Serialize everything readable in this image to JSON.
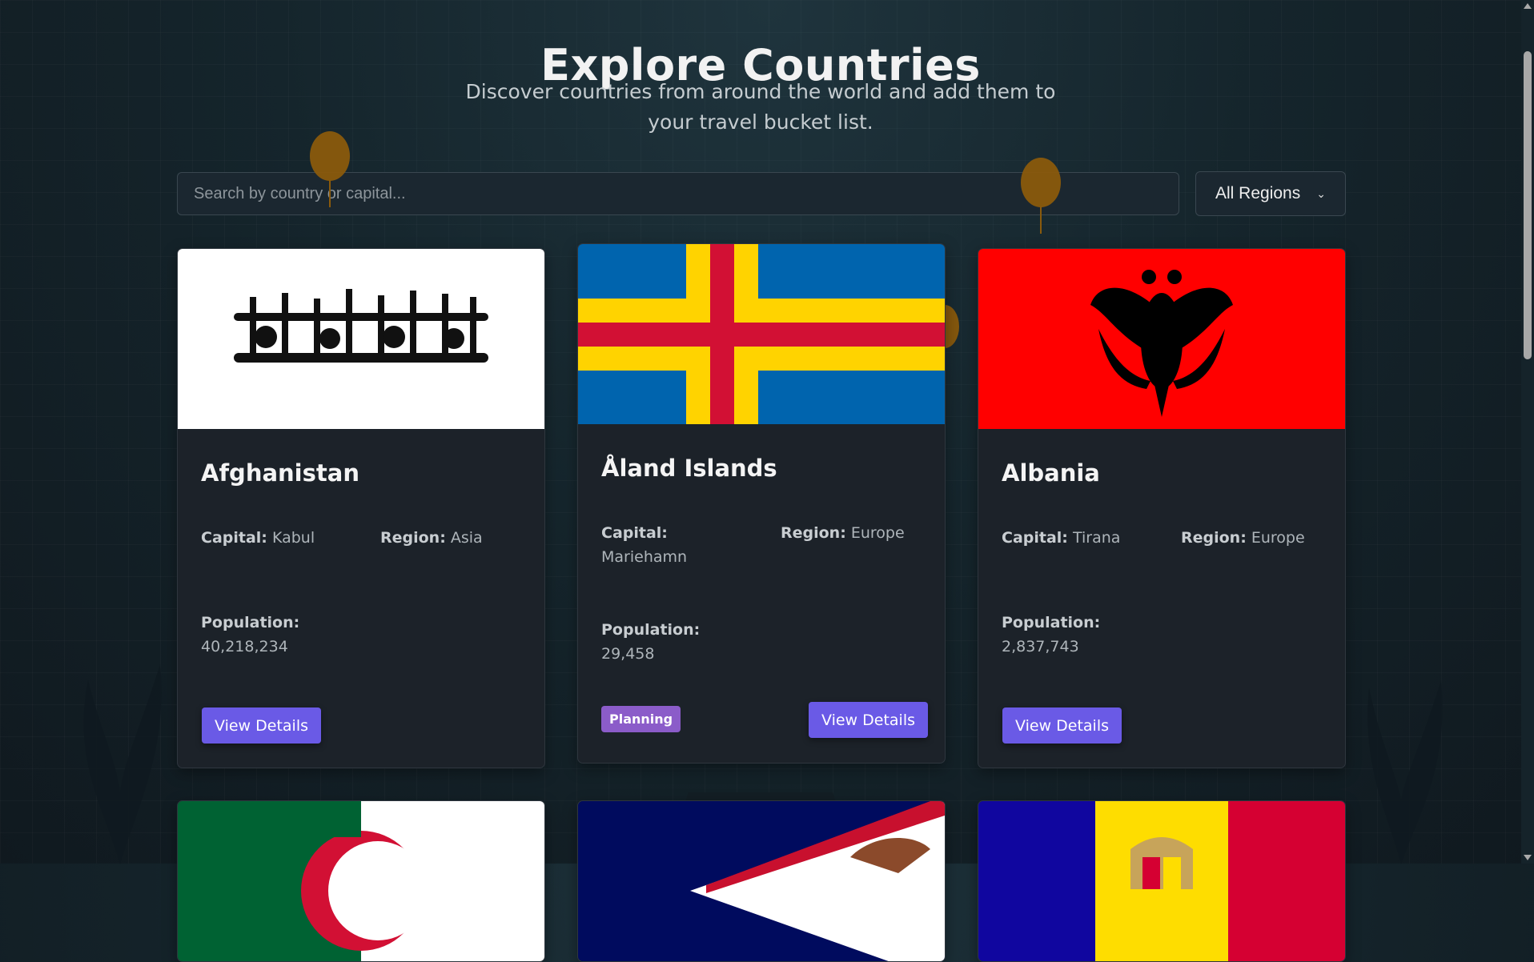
{
  "header": {
    "title": "Explore Countries",
    "subtitle_line1": "Discover countries from around the world and add them to",
    "subtitle_line2": "your travel bucket list."
  },
  "search": {
    "placeholder": "Search by country or capital..."
  },
  "region_filter": {
    "selected": "All Regions"
  },
  "labels": {
    "capital": "Capital:",
    "region": "Region:",
    "population": "Population:",
    "view_details": "View Details"
  },
  "countries": [
    {
      "name": "Afghanistan",
      "capital": "Kabul",
      "region": "Asia",
      "population": "40,218,234",
      "status": ""
    },
    {
      "name": "Åland Islands",
      "capital": "Mariehamn",
      "region": "Europe",
      "population": "29,458",
      "status": "Planning"
    },
    {
      "name": "Albania",
      "capital": "Tirana",
      "region": "Europe",
      "population": "2,837,743",
      "status": ""
    }
  ],
  "colors": {
    "accent": "#6a5ae6",
    "badge": "#8b5cc9",
    "balloon": "#8a5a0c",
    "card_bg": "#1c2229"
  }
}
